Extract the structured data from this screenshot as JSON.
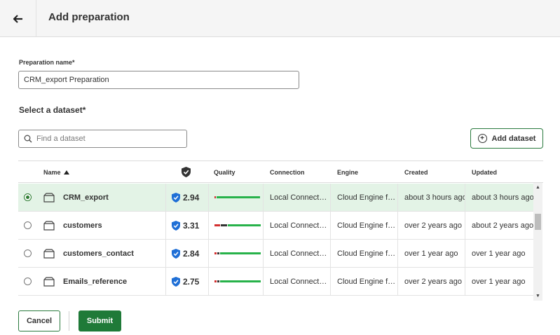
{
  "header": {
    "title": "Add preparation",
    "back_icon": "arrow-left-icon"
  },
  "form": {
    "name_label": "Preparation name*",
    "name_value": "CRM_export Preparation",
    "select_title": "Select a dataset*"
  },
  "search": {
    "placeholder": "Find a dataset"
  },
  "add_dataset_label": "Add dataset",
  "table": {
    "columns": {
      "name": "Name",
      "quality": "Quality",
      "connection": "Connection",
      "engine": "Engine",
      "created": "Created",
      "updated": "Updated"
    },
    "rows": [
      {
        "name": "CRM_export",
        "score": "2.94",
        "connection": "Local Connect…",
        "engine": "Cloud Engine f…",
        "created": "about 3 hours ago",
        "updated": "about 3 hours ago",
        "selected": true,
        "quality": {
          "invalid": 0.03,
          "empty": 0.0,
          "valid": 0.97
        }
      },
      {
        "name": "customers",
        "score": "3.31",
        "connection": "Local Connect…",
        "engine": "Cloud Engine f…",
        "created": "over 2 years ago",
        "updated": "about 2 years ago",
        "selected": false,
        "quality": {
          "invalid": 0.12,
          "empty": 0.14,
          "valid": 0.74
        }
      },
      {
        "name": "customers_contact",
        "score": "2.84",
        "connection": "Local Connect…",
        "engine": "Cloud Engine f…",
        "created": "over 1 year ago",
        "updated": "over 1 year ago",
        "selected": false,
        "quality": {
          "invalid": 0.05,
          "empty": 0.05,
          "valid": 0.9
        }
      },
      {
        "name": "Emails_reference",
        "score": "2.75",
        "connection": "Local Connect…",
        "engine": "Cloud Engine f…",
        "created": "over 2 years ago",
        "updated": "over 1 year ago",
        "selected": false,
        "quality": {
          "invalid": 0.05,
          "empty": 0.05,
          "valid": 0.9
        }
      }
    ]
  },
  "footer": {
    "cancel_label": "Cancel",
    "submit_label": "Submit"
  },
  "colors": {
    "accent": "#1f7a38",
    "selected_row": "#e3f3e6",
    "quality_valid": "#27b24a",
    "quality_invalid": "#d32f2f",
    "quality_empty": "#333333",
    "trust_badge": "#1f6fd6"
  }
}
